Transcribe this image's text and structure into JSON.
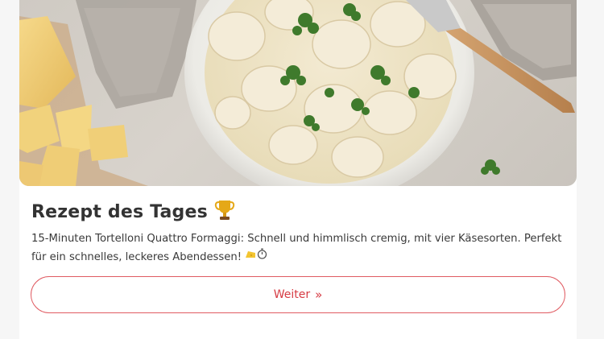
{
  "card": {
    "title": "Rezept des Tages",
    "title_icon": "trophy-icon",
    "description": "15-Minuten Tortelloni Quattro Formaggi: Schnell und himmlisch cremig, mit vier Käsesorten. Perfekt für ein schnelles, leckeres Abendessen!",
    "description_icons": [
      "cheese-icon",
      "stopwatch-icon"
    ],
    "button_label": "Weiter",
    "button_icon": "double-chevron-right-icon"
  },
  "colors": {
    "accent": "#d63b43",
    "title_text": "#333333",
    "body_text": "#3a3a3a"
  }
}
